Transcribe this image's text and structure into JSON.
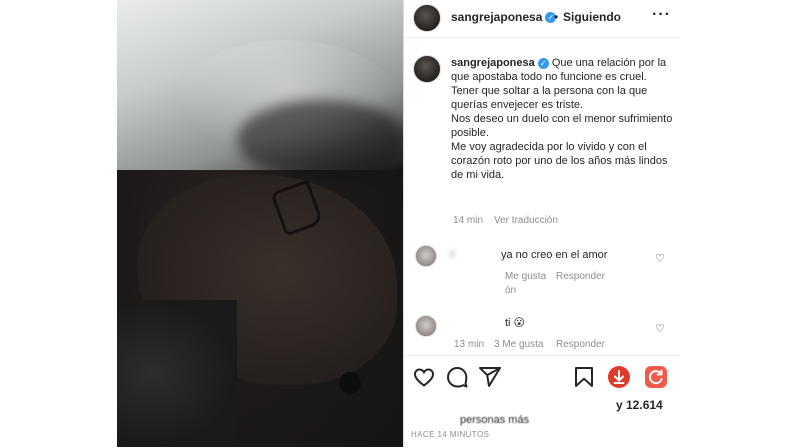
{
  "header": {
    "username": "sangrejaponesa",
    "separator": "•",
    "follow_label": "Siguiendo",
    "more_label": "···"
  },
  "caption": {
    "username": "sangrejaponesa",
    "lines": [
      "Que una relación por la que apostaba todo no funcione es cruel.",
      "Tener que soltar a la persona con la que querías envejecer es triste.",
      "Nos deseo un duelo con el menor sufrimiento posible.",
      "Me voy agradecida por lo vivido y con el corazón roto por uno de los años más lindos de mi vida."
    ],
    "time": "14 min",
    "translate_label": "Ver traducción"
  },
  "comments": [
    {
      "username": "l",
      "text": "ya no creo en el amor",
      "likes_label": "Me gusta",
      "reply_label": "Responder",
      "extra": "ón"
    },
    {
      "username": "",
      "text": "ti 😮",
      "time": "13 min",
      "likes_label": "3 Me gusta",
      "reply_label": "Responder"
    }
  ],
  "actions": {
    "likes_count": "y 12.614",
    "likes_text_partial": "personas más",
    "timestamp": "HACE 14 MINUTOS"
  },
  "icons": [
    "heart-icon",
    "comment-icon",
    "share-icon",
    "bookmark-icon",
    "download-icon",
    "refresh-icon"
  ],
  "colors": {
    "verified_blue": "#3897f0",
    "text": "#262626",
    "secondary": "#8e8e8e",
    "download_red": "#e03a2c",
    "refresh_red": "#f15a4a"
  }
}
